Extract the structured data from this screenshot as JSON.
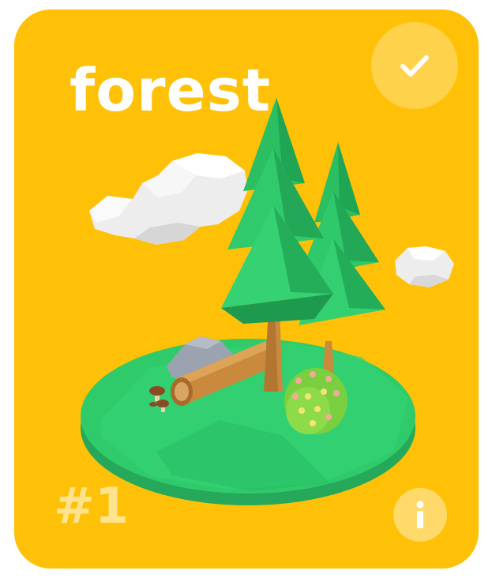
{
  "card": {
    "title": "forest",
    "number": "#1",
    "selected": true,
    "icons": {
      "check": "checkmark-icon",
      "info": "info-icon"
    },
    "colors": {
      "background": "#FFC107",
      "grass": "#2BCB6A",
      "tree": "#2BBE62",
      "trunk": "#C98A3E",
      "cloud": "#F1F1F1"
    }
  }
}
